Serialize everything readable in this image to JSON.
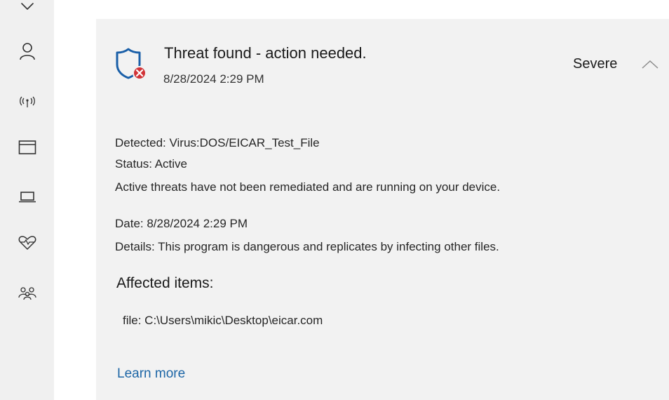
{
  "sidebar": {
    "icons": [
      {
        "name": "shield-icon-partial"
      },
      {
        "name": "account-icon"
      },
      {
        "name": "network-icon"
      },
      {
        "name": "app-browser-icon"
      },
      {
        "name": "device-security-icon"
      },
      {
        "name": "health-icon"
      },
      {
        "name": "family-icon"
      }
    ]
  },
  "threat": {
    "title": "Threat found - action needed.",
    "timestamp": "8/28/2024 2:29 PM",
    "severity": "Severe",
    "detected": "Detected:  Virus:DOS/EICAR_Test_File",
    "status": "Status:  Active",
    "status_message": "Active threats have not been remediated and are running on your device.",
    "date": "Date:  8/28/2024 2:29 PM",
    "details": "Details:  This program is dangerous and replicates by infecting other files.",
    "affected_heading": "Affected items:",
    "affected_items": [
      "file: C:\\Users\\mikic\\Desktop\\eicar.com"
    ],
    "learn_more": "Learn more"
  },
  "colors": {
    "sidebar_bg": "#f0f0f0",
    "card_bg": "#f2f2f2",
    "link": "#1d66a6",
    "shield_blue": "#1a5fa8",
    "alert_red": "#d13438"
  }
}
